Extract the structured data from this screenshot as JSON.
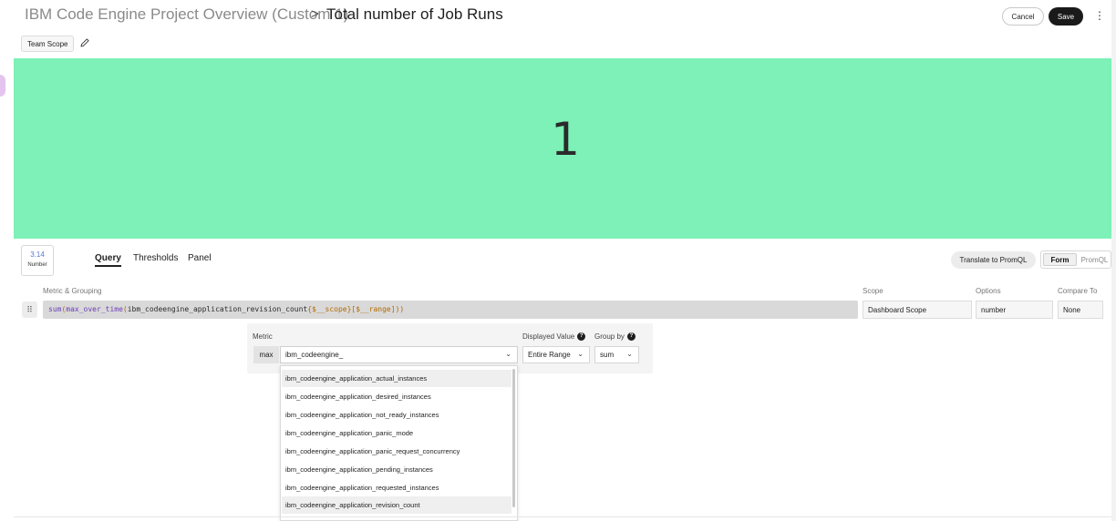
{
  "header": {
    "parent_title": "IBM Code Engine Project Overview (Custom 1)",
    "separator": ">",
    "title": "Total number of Job Runs",
    "cancel_label": "Cancel",
    "save_label": "Save",
    "more_icon": "kebab-icon"
  },
  "scope": {
    "label": "Team Scope",
    "edit_icon": "pencil-icon"
  },
  "panel": {
    "value": "1",
    "background": "#7df1b7"
  },
  "viz": {
    "number": "3.14",
    "label": "Number"
  },
  "tabs": [
    {
      "label": "Query",
      "active": true
    },
    {
      "label": "Thresholds",
      "active": false
    },
    {
      "label": "Panel",
      "active": false
    }
  ],
  "actions": {
    "translate_label": "Translate to PromQL",
    "mode_form": "Form",
    "mode_promql": "PromQL",
    "mode_selected": "Form"
  },
  "columns": {
    "metric_grouping": "Metric & Grouping",
    "scope": "Scope",
    "options": "Options",
    "compare": "Compare To"
  },
  "query": {
    "fn1": "sum",
    "fn2": "max_over_time",
    "metric": "ibm_codeengine_application_revision_count",
    "scope_var": "$__scope",
    "range_var": "$__range",
    "scope_value": "Dashboard Scope",
    "options_value": "number",
    "compare_value": "None"
  },
  "metric_editor": {
    "metric_label": "Metric",
    "displayed_label": "Displayed Value",
    "groupby_label": "Group by",
    "aggregation": "max",
    "metric_value": "ibm_codeengine_",
    "displayed_value": "Entire Range",
    "groupby_value": "sum"
  },
  "suggestions": [
    "ibm_codeengine_application_actual_instances",
    "ibm_codeengine_application_desired_instances",
    "ibm_codeengine_application_not_ready_instances",
    "ibm_codeengine_application_panic_mode",
    "ibm_codeengine_application_panic_request_concurrency",
    "ibm_codeengine_application_pending_instances",
    "ibm_codeengine_application_requested_instances",
    "ibm_codeengine_application_revision_count"
  ]
}
